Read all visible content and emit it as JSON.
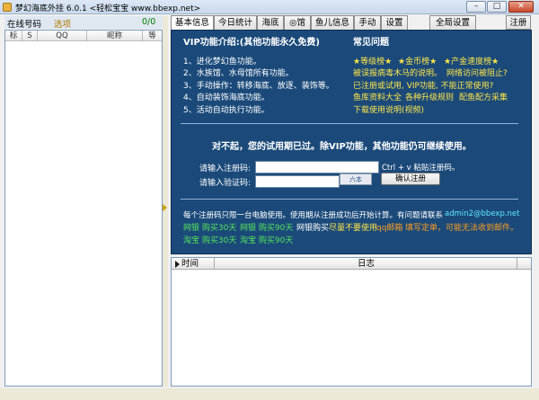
{
  "window": {
    "title": "梦幻海底外挂 6.0.1 <轻松宝宝 www.bbexp.net>",
    "buttons": {
      "minimize": "–",
      "maximize": "□",
      "close": "✕"
    }
  },
  "left": {
    "online_label": "在线号码",
    "options_label": "选项",
    "count": "0/0",
    "columns": [
      "标",
      "S",
      "QQ",
      "昵称",
      "等"
    ]
  },
  "tabs": [
    "基本信息",
    "今日统计",
    "海底",
    "◎馆",
    "鱼儿信息",
    "手动",
    "设置"
  ],
  "global_tab": "全局设置",
  "register_button": "注册",
  "panel": {
    "vip_title": "VIP功能介绍:(其他功能永久免费)",
    "faq_title": "常见问题",
    "features": [
      "1、进化梦幻鱼功能。",
      "2、水族馆、水母馆所有功能。",
      "3、手动操作：转移海底、放逐、装饰等。",
      "4、自动装饰海底功能。",
      "5、活动自动执行功能。"
    ],
    "rank_level": "★等级榜★",
    "rank_gold": "★金币榜★",
    "rank_speed": "★产金速度榜★",
    "faq1": "被误报病毒木马的说明。",
    "faq1b": "网络访问被阻止?",
    "faq2": "已注册或试用, VIP功能, 不能正常使用?",
    "faq3a": "鱼库资料大全",
    "faq3b": "各种升级规则",
    "faq3c": "配鱼配方采集",
    "faq4": "下载使用说明(视频)",
    "trial_msg": "对不起，您的试用期已过。除VIP功能，其他功能仍可继续使用。",
    "reg_code_label": "请输入注册码:",
    "reg_code_value": "",
    "paste_hint": "Ctrl + v 粘贴注册码。",
    "verify_label": "请输入验证码:",
    "verify_value": "",
    "captcha_text": "六本",
    "confirm_button": "确认注册",
    "note": "每个注册码只限一台电脑使用。使用期从注册成功后开始计算。有问题请联系",
    "email": "admin2@bbexp.net",
    "pay1": "网银 购买30天",
    "pay2": "网银 购买90天",
    "pay3": "网银购买",
    "pay_note_white": "尽量不要使用",
    "pay_note_qq": "qq邮箱",
    "pay_note_rest": "填写定单，可能无法收到邮件。",
    "pay4": "淘宝 购买30天",
    "pay5": "淘宝 购买90天"
  },
  "log": {
    "col_time": "时间",
    "col_log": "日志"
  }
}
